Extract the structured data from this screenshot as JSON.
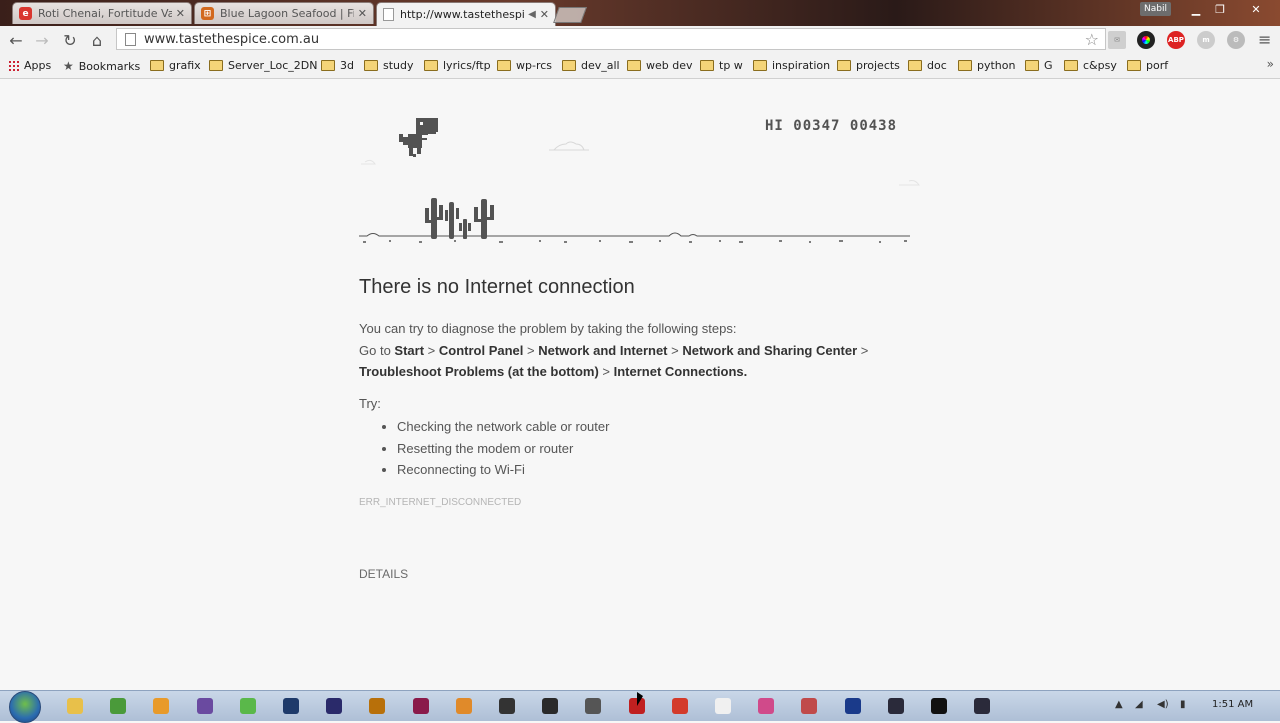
{
  "browser": {
    "user": "Nabil",
    "tabs": [
      {
        "title": "Roti Chenai, Fortitude Valley",
        "favicon": "e",
        "color": "#d9362f"
      },
      {
        "title": "Blue Lagoon Seafood | Fish",
        "favicon": "⊞",
        "color": "#d2691e"
      },
      {
        "title": "http://www.tastethespice",
        "favicon": "",
        "color": "#ffffff"
      }
    ],
    "address": "www.tastethespice.com.au"
  },
  "bookmarks": {
    "apps": "Apps",
    "bookmarks": "Bookmarks",
    "folders": [
      "grafix",
      "Server_Loc_2DN",
      "3d",
      "study",
      "lyrics/ftp",
      "wp-rcs",
      "dev_all",
      "web dev",
      "tp w",
      "inspiration",
      "projects",
      "doc",
      "python",
      "G",
      "c&psy",
      "porf"
    ]
  },
  "game": {
    "hi_label": "HI",
    "hi_score": "00347",
    "score": "00438"
  },
  "error": {
    "title": "There is no Internet connection",
    "intro": "You can try to diagnose the problem by taking the following steps:",
    "goto": "Go to",
    "steps": [
      "Start",
      "Control Panel",
      "Network and Internet",
      "Network and Sharing Center",
      "Troubleshoot Problems (at the bottom)",
      "Internet Connections."
    ],
    "try_label": "Try:",
    "suggestions": [
      "Checking the network cable or router",
      "Resetting the modem or router",
      "Reconnecting to Wi-Fi"
    ],
    "code": "ERR_INTERNET_DISCONNECTED",
    "details": "DETAILS"
  },
  "taskbar": {
    "clock": "1:51 AM",
    "apps": [
      {
        "name": "explorer-icon",
        "color": "#e8c04a"
      },
      {
        "name": "network-icon",
        "color": "#4a9a3a"
      },
      {
        "name": "media-player-icon",
        "color": "#e89a2a"
      },
      {
        "name": "visual-studio-icon",
        "color": "#6a4aa0"
      },
      {
        "name": "spotify-icon",
        "color": "#5ab84a"
      },
      {
        "name": "photoshop-icon",
        "color": "#1e3a6a"
      },
      {
        "name": "after-effects-icon",
        "color": "#2a2a6a"
      },
      {
        "name": "illustrator-icon",
        "color": "#b8700a"
      },
      {
        "name": "indesign-icon",
        "color": "#8a1a4a"
      },
      {
        "name": "blender-icon",
        "color": "#e08a2a"
      },
      {
        "name": "unity-icon",
        "color": "#333333"
      },
      {
        "name": "unreal-icon",
        "color": "#2a2a2a"
      },
      {
        "name": "calculator-icon",
        "color": "#555555"
      },
      {
        "name": "acrobat-icon",
        "color": "#c02020"
      },
      {
        "name": "chrome-icon",
        "color": "#d33a2a"
      },
      {
        "name": "c-app-icon",
        "color": "#f0f0f0"
      },
      {
        "name": "creative-cloud-icon",
        "color": "#d04a8a"
      },
      {
        "name": "tool-icon",
        "color": "#c04a4a"
      },
      {
        "name": "lightroom-icon",
        "color": "#1a3a8a"
      },
      {
        "name": "fiddler-icon",
        "color": "#2a2a3a"
      },
      {
        "name": "terminal-icon",
        "color": "#111111"
      },
      {
        "name": "git-icon",
        "color": "#2a2a3a"
      }
    ]
  }
}
